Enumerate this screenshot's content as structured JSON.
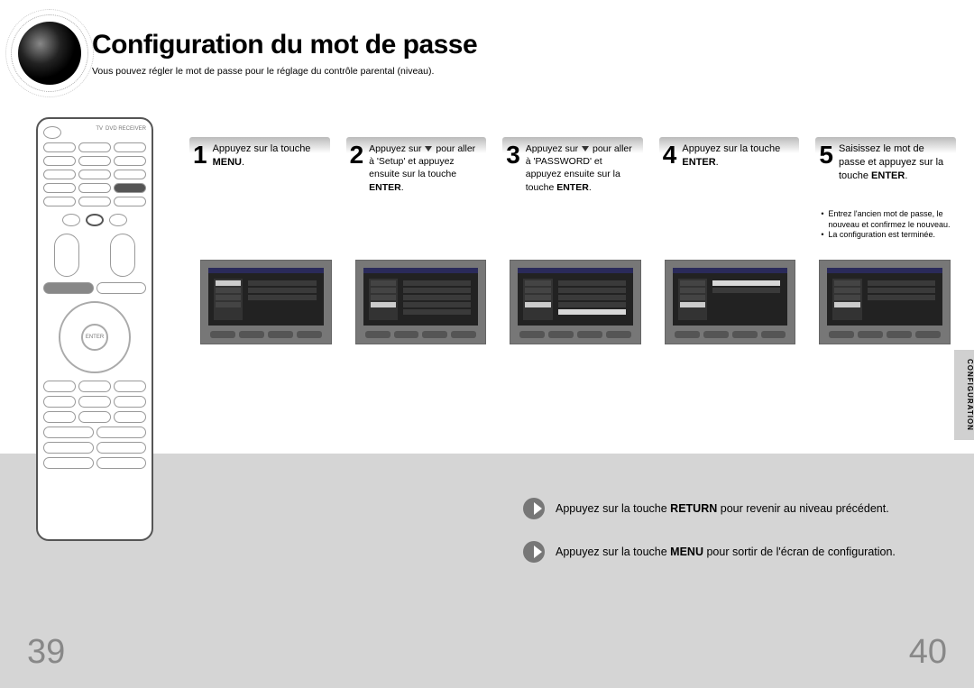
{
  "title": "Configuration du mot de passe",
  "subtitle": "Vous pouvez régler le mot de passe pour le réglage du contrôle parental (niveau).",
  "steps": [
    {
      "num": "1",
      "text": "Appuyez sur la touche <b>MENU</b>."
    },
    {
      "num": "2",
      "text": "Appuyez sur <span class='arrow-down'></span> pour aller à 'Setup' et appuyez ensuite sur la touche <b>ENTER</b>."
    },
    {
      "num": "3",
      "text": "Appuyez sur <span class='arrow-down'></span> pour aller à 'PASSWORD' et appuyez ensuite sur la touche <b>ENTER</b>."
    },
    {
      "num": "4",
      "text": "Appuyez sur la touche <b>ENTER</b>."
    },
    {
      "num": "5",
      "text": "Saisissez le mot de passe et appuyez sur la touche <b>ENTER</b>."
    }
  ],
  "step5_notes": [
    "Entrez l'ancien mot de passe, le nouveau et confirmez le nouveau.",
    "La configuration est terminée."
  ],
  "side_tab": "CONFIGURATION",
  "tips": [
    "Appuyez sur la touche <b>RETURN</b> pour revenir au niveau précédent.",
    "Appuyez sur la touche <b>MENU</b> pour sortir de l'écran de configuration."
  ],
  "page_left": "39",
  "page_right": "40",
  "remote_center": "ENTER"
}
